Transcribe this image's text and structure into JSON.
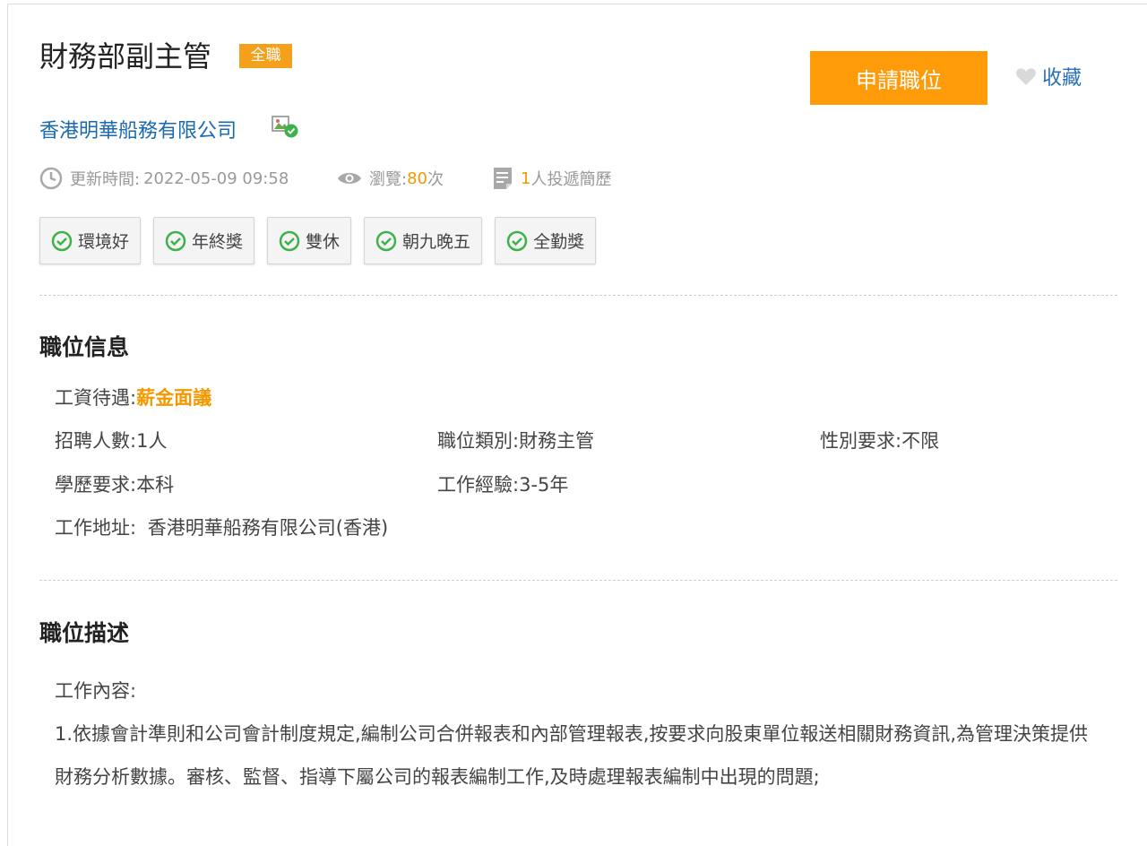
{
  "job": {
    "title": "財務部副主管",
    "type_badge": "全職",
    "company": "香港明華船務有限公司",
    "apply_label": "申請職位",
    "favorite_label": "收藏"
  },
  "meta": {
    "updated_label": "更新時間:",
    "updated_value": "2022-05-09 09:58",
    "views_label": "瀏覽:",
    "views_count": "80",
    "views_unit": "次",
    "applicants_count": "1",
    "applicants_text": "人投遞簡歷"
  },
  "tags": [
    "環境好",
    "年終獎",
    "雙休",
    "朝九晚五",
    "全勤獎"
  ],
  "info": {
    "section_title": "職位信息",
    "salary_label": "工資待遇:",
    "salary_value": "薪金面議",
    "headcount_label": "招聘人數:",
    "headcount_value": "1人",
    "category_label": "職位類別:",
    "category_value": "財務主管",
    "gender_label": "性別要求:",
    "gender_value": "不限",
    "education_label": "學歷要求:",
    "education_value": "本科",
    "experience_label": "工作經驗:",
    "experience_value": "3-5年",
    "address_label": "工作地址:",
    "address_value": "香港明華船務有限公司(香港)"
  },
  "description": {
    "section_title": "職位描述",
    "content_label": "工作內容:",
    "item_1": "1.依據會計準則和公司會計制度規定,編制公司合併報表和內部管理報表,按要求向股東單位報送相關財務資訊,為管理決策提供財務分析數據。審核、監督、指導下屬公司的報表編制工作,及時處理報表編制中出現的問題;"
  },
  "colors": {
    "accent_orange": "#ff9b08",
    "link_blue": "#1a6ab1",
    "check_green": "#3fb14b"
  }
}
